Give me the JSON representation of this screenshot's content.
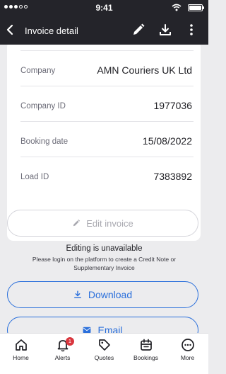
{
  "status_bar": {
    "time": "9:41",
    "signal_icon": "signal-dots-icon",
    "wifi_icon": "wifi-icon",
    "battery_icon": "battery-icon"
  },
  "header": {
    "title": "Invoice detail",
    "back_icon": "chevron-left-icon",
    "actions": [
      "edit-pencil-icon",
      "download-icon",
      "more-vertical-icon"
    ],
    "background": "#24242a"
  },
  "details": {
    "rows": [
      {
        "label": "Company",
        "value": "AMN Couriers UK Ltd"
      },
      {
        "label": "Company ID",
        "value": "1977036"
      },
      {
        "label": "Booking date",
        "value": "15/08/2022"
      },
      {
        "label": "Load ID",
        "value": "7383892"
      }
    ]
  },
  "edit_button": {
    "label": "Edit invoice",
    "icon": "pencil-icon",
    "enabled": false
  },
  "notice": {
    "title": "Editing is unavailable",
    "text": "Please login on the platform to create a Credit Note or Supplementary Invoice"
  },
  "download_button": {
    "label": "Download",
    "icon": "download-icon"
  },
  "email_button": {
    "label": "Email",
    "icon": "envelope-icon"
  },
  "accent_color": "#2a6fdb",
  "tab_bar": {
    "tabs": [
      {
        "label": "Home",
        "icon": "home-icon"
      },
      {
        "label": "Alerts",
        "icon": "bell-icon",
        "badge": "1"
      },
      {
        "label": "Quotes",
        "icon": "tag-icon"
      },
      {
        "label": "Bookings",
        "icon": "calendar-icon"
      },
      {
        "label": "More",
        "icon": "more-horizontal-circle-icon"
      }
    ]
  }
}
